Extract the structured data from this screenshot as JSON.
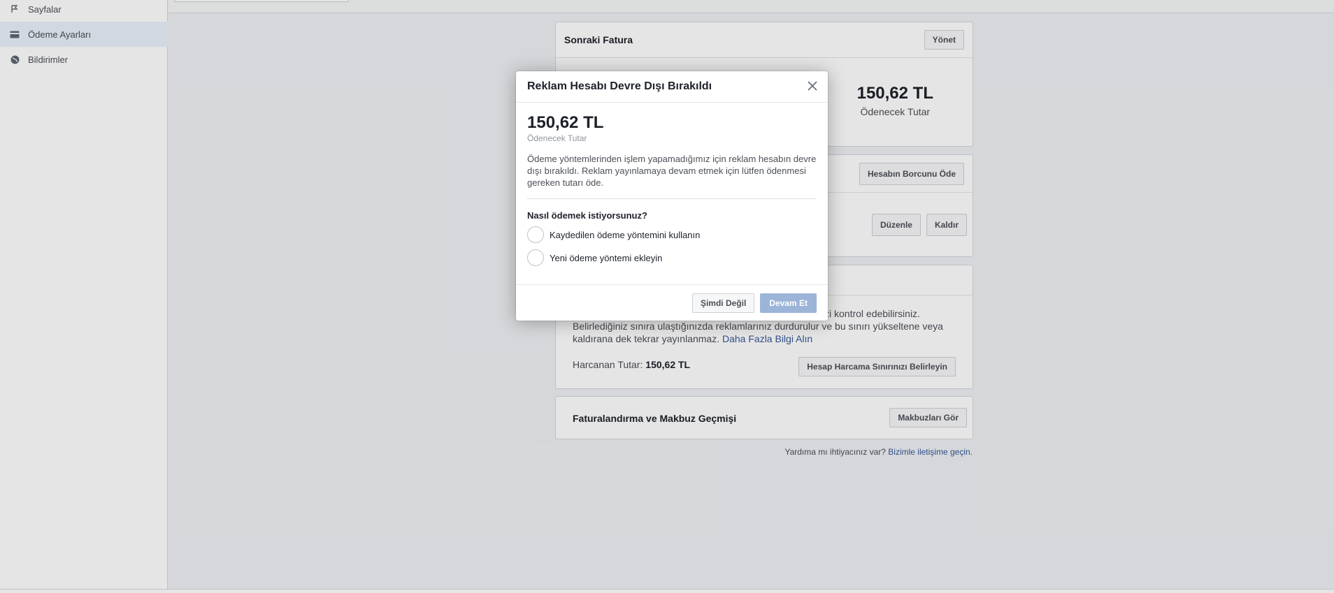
{
  "sidebar": {
    "items": [
      {
        "label": "Sayfalar",
        "icon": "flag-icon"
      },
      {
        "label": "Ödeme Ayarları",
        "icon": "credit-card-icon"
      },
      {
        "label": "Bildirimler",
        "icon": "globe-icon"
      }
    ]
  },
  "next_invoice": {
    "title": "Sonraki Fatura",
    "manage_label": "Yönet",
    "amount": "150,62 TL",
    "amount_label": "Ödenecek Tutar"
  },
  "payment_methods": {
    "pay_balance_label": "Hesabın Borcunu Öde",
    "edit_label": "Düzenle",
    "remove_label": "Kaldır"
  },
  "spending_limit": {
    "text_partial": "zi kontrol edebilirsiniz.",
    "text_line2": "Belirlediğiniz sınıra ulaştığınızda reklamlarınız durdurulur ve bu sınırı yükseltene veya",
    "text_line3": "kaldırana dek tekrar yayınlanmaz.",
    "learn_more": "Daha Fazla Bilgi Alın",
    "spent_label": "Harcanan Tutar:",
    "spent_value": "150,62 TL",
    "set_limit_label": "Hesap Harcama Sınırınızı Belirleyin"
  },
  "billing_history": {
    "title": "Faturalandırma ve Makbuz Geçmişi",
    "view_receipts_label": "Makbuzları Gör"
  },
  "help": {
    "question": "Yardıma mı ihtiyacınız var?",
    "contact_link": "Bizimle iletişime geçin."
  },
  "modal": {
    "title": "Reklam Hesabı Devre Dışı Bırakıldı",
    "amount": "150,62 TL",
    "amount_label": "Ödenecek Tutar",
    "description": "Ödeme yöntemlerinden işlem yapamadığımız için reklam hesabın devre dışı bırakıldı. Reklam yayınlamaya devam etmek için lütfen ödenmesi gereken tutarı öde.",
    "question": "Nasıl ödemek istiyorsunuz?",
    "options": [
      {
        "label": "Kaydedilen ödeme yöntemini kullanın"
      },
      {
        "label": "Yeni ödeme yöntemi ekleyin"
      }
    ],
    "not_now_label": "Şimdi Değil",
    "continue_label": "Devam Et"
  }
}
